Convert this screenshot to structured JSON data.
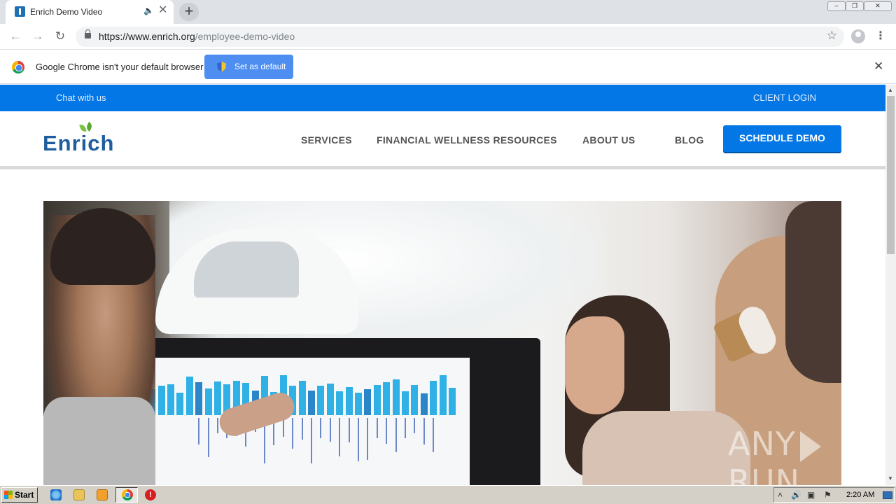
{
  "browser": {
    "tab_title": "Enrich Demo Video",
    "url_host": "https://www.enrich.org",
    "url_path": "/employee-demo-video",
    "infobar_text": "Google Chrome isn't your default browser",
    "infobar_button": "Set as default"
  },
  "site": {
    "topbar": {
      "chat": "Chat with us",
      "login": "CLIENT LOGIN"
    },
    "logo": "Enrich",
    "nav": [
      {
        "label": "SERVICES"
      },
      {
        "label": "FINANCIAL WELLNESS RESOURCES"
      },
      {
        "label": "ABOUT US"
      },
      {
        "label": "BLOG"
      }
    ],
    "cta": "SCHEDULE DEMO"
  },
  "video": {
    "watermark_left": "ANY",
    "watermark_right": "RUN"
  },
  "taskbar": {
    "start": "Start",
    "clock": "2:20 AM"
  }
}
